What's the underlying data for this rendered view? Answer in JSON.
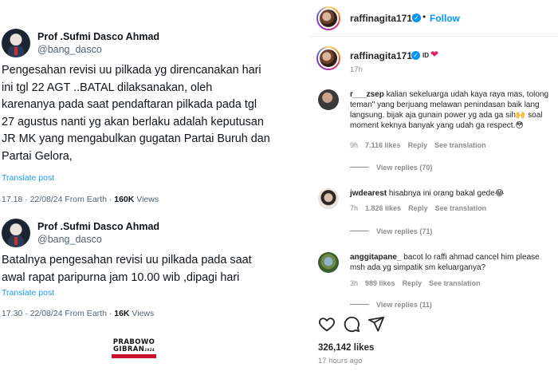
{
  "tweets": [
    {
      "name": "Prof .Sufmi Dasco Ahmad",
      "handle": "@bang_dasco",
      "text": "Pengesahan revisi uu pilkada yg direncanakan hari\nini  tgl 22 AGT ..BATAL dilaksanakan, oleh\nkarenanya pada saat pendaftaran pilkada pada tgl\n27 agustus nanti yg akan berlaku adalah keputusan\nJR  MK yang mengabulkan gugatan Partai Buruh dan\nPartai Gelora,",
      "translate": "Translate post",
      "time": "17.18 · 22/08/24 From Earth · ",
      "views_count": "160K",
      "views_label": " Views"
    },
    {
      "name": "Prof .Sufmi Dasco Ahmad",
      "handle": "@bang_dasco",
      "text": "Batalnya pengesahan revisi uu pilkada pada saat\nawal rapat paripurna jam 10.00 wib ,dipagi hari",
      "translate": "Translate post",
      "time": "17.30 · 22/08/24 From Earth · ",
      "views_count": "16K",
      "views_label": " Views"
    }
  ],
  "logo": {
    "line1": "PRABOWO",
    "line2": "GIBRAN",
    "year": "2024"
  },
  "instagram": {
    "header": {
      "username": "raffinagita1717",
      "separator": "•",
      "follow": "Follow"
    },
    "caption": {
      "username": "raffinagita1717",
      "text": "ID",
      "time": "17h"
    },
    "comments": [
      {
        "username": "r___zsep",
        "lines": [
          " kalian sekeluarga udah kaya raya mas, tolong",
          "teman\" yang berjuang melawan penindasan baik lang",
          "langsung. bijak aja gunain power yg ada ga sih🙌 soal",
          "moment keknya banyak yang udah ga respect.😳"
        ],
        "time": "9h",
        "likes": "7.116 likes",
        "reply": "Reply",
        "translate": "See translation",
        "view_replies": "View replies (70)"
      },
      {
        "username": "jwdearest",
        "lines": [
          " hisabnya ini orang bakal gede😂"
        ],
        "time": "7h",
        "likes": "1.826 likes",
        "reply": "Reply",
        "translate": "See translation",
        "view_replies": "View replies (71)"
      },
      {
        "username": "anggitapane_",
        "lines": [
          " bacot lo raffi ahmad cancel him please",
          "msh ada yg simpatik sm keluarganya?"
        ],
        "time": "3h",
        "likes": "989 likes",
        "reply": "Reply",
        "translate": "See translation",
        "view_replies": "View replies (11)"
      }
    ],
    "likes": "326,142 likes",
    "posted": "17 hours ago",
    "colors": {
      "accent": "#0095f6",
      "muted": "#8e8e8e",
      "heart": "#e0245e"
    },
    "action_icons": [
      "heart-icon",
      "comment-icon",
      "share-icon"
    ]
  }
}
